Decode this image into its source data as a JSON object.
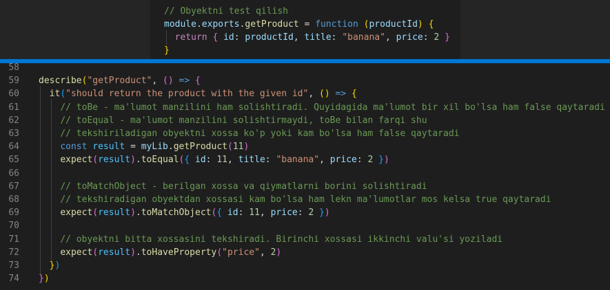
{
  "hover_preview": {
    "lines": [
      [
        {
          "t": "// Obyektni test qilish",
          "c": "c-com"
        }
      ],
      [
        {
          "t": "module",
          "c": "c-var"
        },
        {
          "t": ".",
          "c": "c-txt"
        },
        {
          "t": "exports",
          "c": "c-var"
        },
        {
          "t": ".",
          "c": "c-txt"
        },
        {
          "t": "getProduct",
          "c": "c-fn"
        },
        {
          "t": " = ",
          "c": "c-txt"
        },
        {
          "t": "function",
          "c": "c-kw"
        },
        {
          "t": " ",
          "c": "c-txt"
        },
        {
          "t": "(",
          "c": "c-p1"
        },
        {
          "t": "productId",
          "c": "c-var"
        },
        {
          "t": ")",
          "c": "c-p1"
        },
        {
          "t": " ",
          "c": "c-txt"
        },
        {
          "t": "{",
          "c": "c-p1"
        }
      ],
      [
        {
          "t": "  ",
          "c": "c-txt"
        },
        {
          "t": "return",
          "c": "c-ctl"
        },
        {
          "t": " ",
          "c": "c-txt"
        },
        {
          "t": "{",
          "c": "c-p2"
        },
        {
          "t": " ",
          "c": "c-txt"
        },
        {
          "t": "id",
          "c": "c-var"
        },
        {
          "t": ": ",
          "c": "c-txt"
        },
        {
          "t": "productId",
          "c": "c-var"
        },
        {
          "t": ", ",
          "c": "c-txt"
        },
        {
          "t": "title",
          "c": "c-var"
        },
        {
          "t": ": ",
          "c": "c-txt"
        },
        {
          "t": "\"banana\"",
          "c": "c-str"
        },
        {
          "t": ", ",
          "c": "c-txt"
        },
        {
          "t": "price",
          "c": "c-var"
        },
        {
          "t": ": ",
          "c": "c-txt"
        },
        {
          "t": "2",
          "c": "c-num"
        },
        {
          "t": " ",
          "c": "c-txt"
        },
        {
          "t": "}",
          "c": "c-p2"
        }
      ],
      [
        {
          "t": "}",
          "c": "c-p1"
        }
      ]
    ]
  },
  "editor": {
    "lines": [
      {
        "num": "58",
        "tokens": []
      },
      {
        "num": "59",
        "tokens": [
          {
            "t": "describe",
            "c": "c-fn"
          },
          {
            "t": "(",
            "c": "c-p1"
          },
          {
            "t": "\"getProduct\"",
            "c": "c-str"
          },
          {
            "t": ", ",
            "c": "c-txt"
          },
          {
            "t": "()",
            "c": "c-p2"
          },
          {
            "t": " ",
            "c": "c-txt"
          },
          {
            "t": "=>",
            "c": "c-kw"
          },
          {
            "t": " ",
            "c": "c-txt"
          },
          {
            "t": "{",
            "c": "c-p2"
          }
        ]
      },
      {
        "num": "60",
        "tokens": [
          {
            "t": "  ",
            "c": "c-txt"
          },
          {
            "t": "it",
            "c": "c-fn"
          },
          {
            "t": "(",
            "c": "c-p3"
          },
          {
            "t": "\"should return the product with the given id\"",
            "c": "c-str"
          },
          {
            "t": ", ",
            "c": "c-txt"
          },
          {
            "t": "()",
            "c": "c-p1"
          },
          {
            "t": " ",
            "c": "c-txt"
          },
          {
            "t": "=>",
            "c": "c-kw"
          },
          {
            "t": " ",
            "c": "c-txt"
          },
          {
            "t": "{",
            "c": "c-p1"
          }
        ]
      },
      {
        "num": "61",
        "tokens": [
          {
            "t": "    ",
            "c": "c-txt"
          },
          {
            "t": "// toBe - ma'lumot manzilini ham solishtiradi. Quyidagida ma'lumot bir xil bo'lsa ham false qaytaradi",
            "c": "c-com"
          }
        ]
      },
      {
        "num": "62",
        "tokens": [
          {
            "t": "    ",
            "c": "c-txt"
          },
          {
            "t": "// toEqual - ma'lumot manzilini solishtirmaydi, toBe bilan farqi shu",
            "c": "c-com"
          }
        ]
      },
      {
        "num": "63",
        "tokens": [
          {
            "t": "    ",
            "c": "c-txt"
          },
          {
            "t": "// tekshiriladigan obyektni xossa ko'p yoki kam bo'lsa ham false qaytaradi",
            "c": "c-com"
          }
        ]
      },
      {
        "num": "64",
        "tokens": [
          {
            "t": "    ",
            "c": "c-txt"
          },
          {
            "t": "const",
            "c": "c-kw"
          },
          {
            "t": " ",
            "c": "c-txt"
          },
          {
            "t": "result",
            "c": "c-const"
          },
          {
            "t": " = ",
            "c": "c-txt"
          },
          {
            "t": "myLib",
            "c": "c-var"
          },
          {
            "t": ".",
            "c": "c-txt"
          },
          {
            "t": "getProduct",
            "c": "c-fn"
          },
          {
            "t": "(",
            "c": "c-p2"
          },
          {
            "t": "11",
            "c": "c-num"
          },
          {
            "t": ")",
            "c": "c-p2"
          }
        ]
      },
      {
        "num": "65",
        "tokens": [
          {
            "t": "    ",
            "c": "c-txt"
          },
          {
            "t": "expect",
            "c": "c-fn"
          },
          {
            "t": "(",
            "c": "c-p2"
          },
          {
            "t": "result",
            "c": "c-const"
          },
          {
            "t": ")",
            "c": "c-p2"
          },
          {
            "t": ".",
            "c": "c-txt"
          },
          {
            "t": "toEqual",
            "c": "c-fn"
          },
          {
            "t": "(",
            "c": "c-p2"
          },
          {
            "t": "{",
            "c": "c-p3"
          },
          {
            "t": " ",
            "c": "c-txt"
          },
          {
            "t": "id",
            "c": "c-var"
          },
          {
            "t": ": ",
            "c": "c-txt"
          },
          {
            "t": "11",
            "c": "c-num"
          },
          {
            "t": ", ",
            "c": "c-txt"
          },
          {
            "t": "title",
            "c": "c-var"
          },
          {
            "t": ": ",
            "c": "c-txt"
          },
          {
            "t": "\"banana\"",
            "c": "c-str"
          },
          {
            "t": ", ",
            "c": "c-txt"
          },
          {
            "t": "price",
            "c": "c-var"
          },
          {
            "t": ": ",
            "c": "c-txt"
          },
          {
            "t": "2",
            "c": "c-num"
          },
          {
            "t": " ",
            "c": "c-txt"
          },
          {
            "t": "}",
            "c": "c-p3"
          },
          {
            "t": ")",
            "c": "c-p2"
          }
        ]
      },
      {
        "num": "66",
        "tokens": []
      },
      {
        "num": "67",
        "tokens": [
          {
            "t": "    ",
            "c": "c-txt"
          },
          {
            "t": "// toMatchObject - berilgan xossa va qiymatlarni borini solishtiradi",
            "c": "c-com"
          }
        ]
      },
      {
        "num": "68",
        "tokens": [
          {
            "t": "    ",
            "c": "c-txt"
          },
          {
            "t": "// tekshiradigan obyektdan xossasi kam bo'lsa ham lekn ma'lumotlar mos kelsa true qaytaradi",
            "c": "c-com"
          }
        ]
      },
      {
        "num": "69",
        "tokens": [
          {
            "t": "    ",
            "c": "c-txt"
          },
          {
            "t": "expect",
            "c": "c-fn"
          },
          {
            "t": "(",
            "c": "c-p2"
          },
          {
            "t": "result",
            "c": "c-const"
          },
          {
            "t": ")",
            "c": "c-p2"
          },
          {
            "t": ".",
            "c": "c-txt"
          },
          {
            "t": "toMatchObject",
            "c": "c-fn"
          },
          {
            "t": "(",
            "c": "c-p2"
          },
          {
            "t": "{",
            "c": "c-p3"
          },
          {
            "t": " ",
            "c": "c-txt"
          },
          {
            "t": "id",
            "c": "c-var"
          },
          {
            "t": ": ",
            "c": "c-txt"
          },
          {
            "t": "11",
            "c": "c-num"
          },
          {
            "t": ", ",
            "c": "c-txt"
          },
          {
            "t": "price",
            "c": "c-var"
          },
          {
            "t": ": ",
            "c": "c-txt"
          },
          {
            "t": "2",
            "c": "c-num"
          },
          {
            "t": " ",
            "c": "c-txt"
          },
          {
            "t": "}",
            "c": "c-p3"
          },
          {
            "t": ")",
            "c": "c-p2"
          }
        ]
      },
      {
        "num": "70",
        "tokens": []
      },
      {
        "num": "71",
        "tokens": [
          {
            "t": "    ",
            "c": "c-txt"
          },
          {
            "t": "// obyektni bitta xossasini tekshiradi. Birinchi xossasi ikkinchi valu'si yoziladi",
            "c": "c-com"
          }
        ]
      },
      {
        "num": "72",
        "tokens": [
          {
            "t": "    ",
            "c": "c-txt"
          },
          {
            "t": "expect",
            "c": "c-fn"
          },
          {
            "t": "(",
            "c": "c-p2"
          },
          {
            "t": "result",
            "c": "c-const"
          },
          {
            "t": ")",
            "c": "c-p2"
          },
          {
            "t": ".",
            "c": "c-txt"
          },
          {
            "t": "toHaveProperty",
            "c": "c-fn"
          },
          {
            "t": "(",
            "c": "c-p2"
          },
          {
            "t": "\"price\"",
            "c": "c-str"
          },
          {
            "t": ", ",
            "c": "c-txt"
          },
          {
            "t": "2",
            "c": "c-num"
          },
          {
            "t": ")",
            "c": "c-p2"
          }
        ]
      },
      {
        "num": "73",
        "tokens": [
          {
            "t": "  ",
            "c": "c-txt"
          },
          {
            "t": "}",
            "c": "c-p1"
          },
          {
            "t": ")",
            "c": "c-p3"
          }
        ]
      },
      {
        "num": "74",
        "tokens": [
          {
            "t": "}",
            "c": "c-p2"
          },
          {
            "t": ")",
            "c": "c-p1"
          }
        ]
      }
    ]
  }
}
